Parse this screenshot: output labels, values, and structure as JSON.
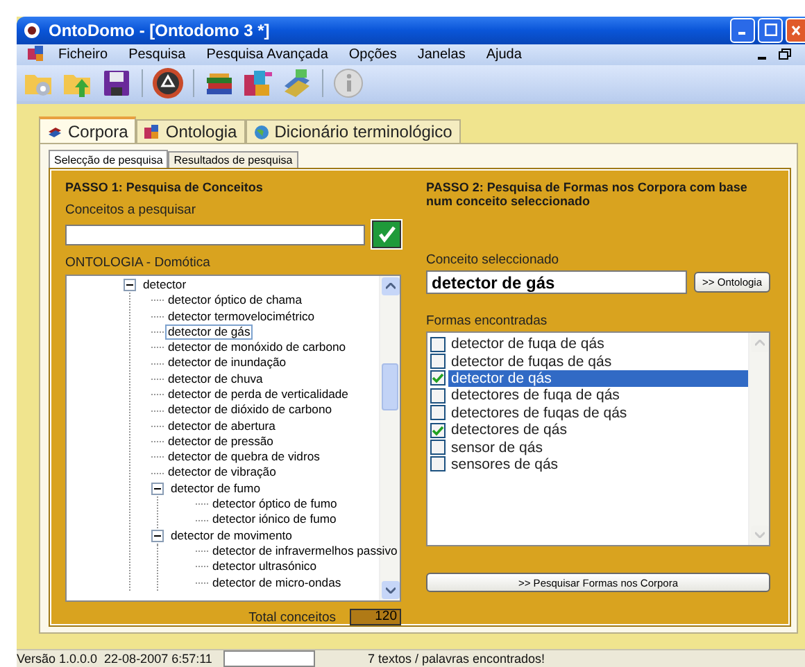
{
  "window": {
    "title": "OntoDomo - [Ontodomo 3 *]"
  },
  "menu": [
    "Ficheiro",
    "Pesquisa",
    "Pesquisa Avançada",
    "Opções",
    "Janelas",
    "Ajuda"
  ],
  "tabs": [
    {
      "label": "Corpora",
      "selected": true
    },
    {
      "label": "Ontologia",
      "selected": false
    },
    {
      "label": "Dicionário terminológico",
      "selected": false
    }
  ],
  "subtabs": [
    {
      "label": "Selecção de pesquisa",
      "selected": true
    },
    {
      "label": "Resultados de pesquisa",
      "selected": false
    }
  ],
  "step1": {
    "heading": "PASSO 1: Pesquisa de Conceitos",
    "search_label": "Conceitos a pesquisar",
    "tree_label": "ONTOLOGIA - Domótica",
    "total_label": "Total conceitos",
    "total": "120"
  },
  "tree": [
    {
      "label": "detector",
      "selected": false,
      "expanded": true,
      "children": [
        {
          "label": "detector óptico de chama",
          "selected": false
        },
        {
          "label": "detector termovelocimétrico",
          "selected": false
        },
        {
          "label": "detector de gás",
          "selected": true
        },
        {
          "label": "detector de monóxido de carbono",
          "selected": false
        },
        {
          "label": "detector de inundação",
          "selected": false
        },
        {
          "label": "detector de chuva",
          "selected": false
        },
        {
          "label": "detector de perda de verticalidade",
          "selected": false
        },
        {
          "label": "detector de dióxido de carbono",
          "selected": false
        },
        {
          "label": "detector de abertura",
          "selected": false
        },
        {
          "label": "detector de pressão",
          "selected": false
        },
        {
          "label": "detector de quebra de vidros",
          "selected": false
        },
        {
          "label": "detector de vibração",
          "selected": false
        },
        {
          "label": "detector de fumo",
          "selected": false,
          "expanded": true,
          "children": [
            {
              "label": "detector óptico de fumo",
              "selected": false
            },
            {
              "label": "detector iónico de fumo",
              "selected": false
            }
          ]
        },
        {
          "label": "detector de movimento",
          "selected": false,
          "expanded": true,
          "children": [
            {
              "label": "detector de infravermelhos passivo",
              "selected": false
            },
            {
              "label": "detector ultrasónico",
              "selected": false
            },
            {
              "label": "detector de micro-ondas",
              "selected": false
            }
          ]
        }
      ]
    }
  ],
  "step2": {
    "heading": "PASSO 2: Pesquisa de Formas nos Corpora com base num conceito seleccionado",
    "concept_label": "Conceito seleccionado",
    "concept_value": "detector de gás",
    "ontology_button": ">> Ontologia",
    "forms_label": "Formas encontradas",
    "search_button": ">> Pesquisar Formas nos Corpora"
  },
  "forms": [
    {
      "label": "detector de fuqa de qás",
      "checked": false,
      "selected": false
    },
    {
      "label": "detector de fuqas de qás",
      "checked": false,
      "selected": false
    },
    {
      "label": "detector de qás",
      "checked": true,
      "selected": true
    },
    {
      "label": "detectores de fuqa de qás",
      "checked": false,
      "selected": false
    },
    {
      "label": "detectores de fuqas de qás",
      "checked": false,
      "selected": false
    },
    {
      "label": "detectores de qás",
      "checked": true,
      "selected": false
    },
    {
      "label": "sensor de qás",
      "checked": false,
      "selected": false
    },
    {
      "label": "sensores de qás",
      "checked": false,
      "selected": false
    }
  ],
  "status_bar": {
    "version": "Versão 1.0.0.0  22-08-2007 6:57:11",
    "message": "7 textos / palavras encontrados!"
  }
}
